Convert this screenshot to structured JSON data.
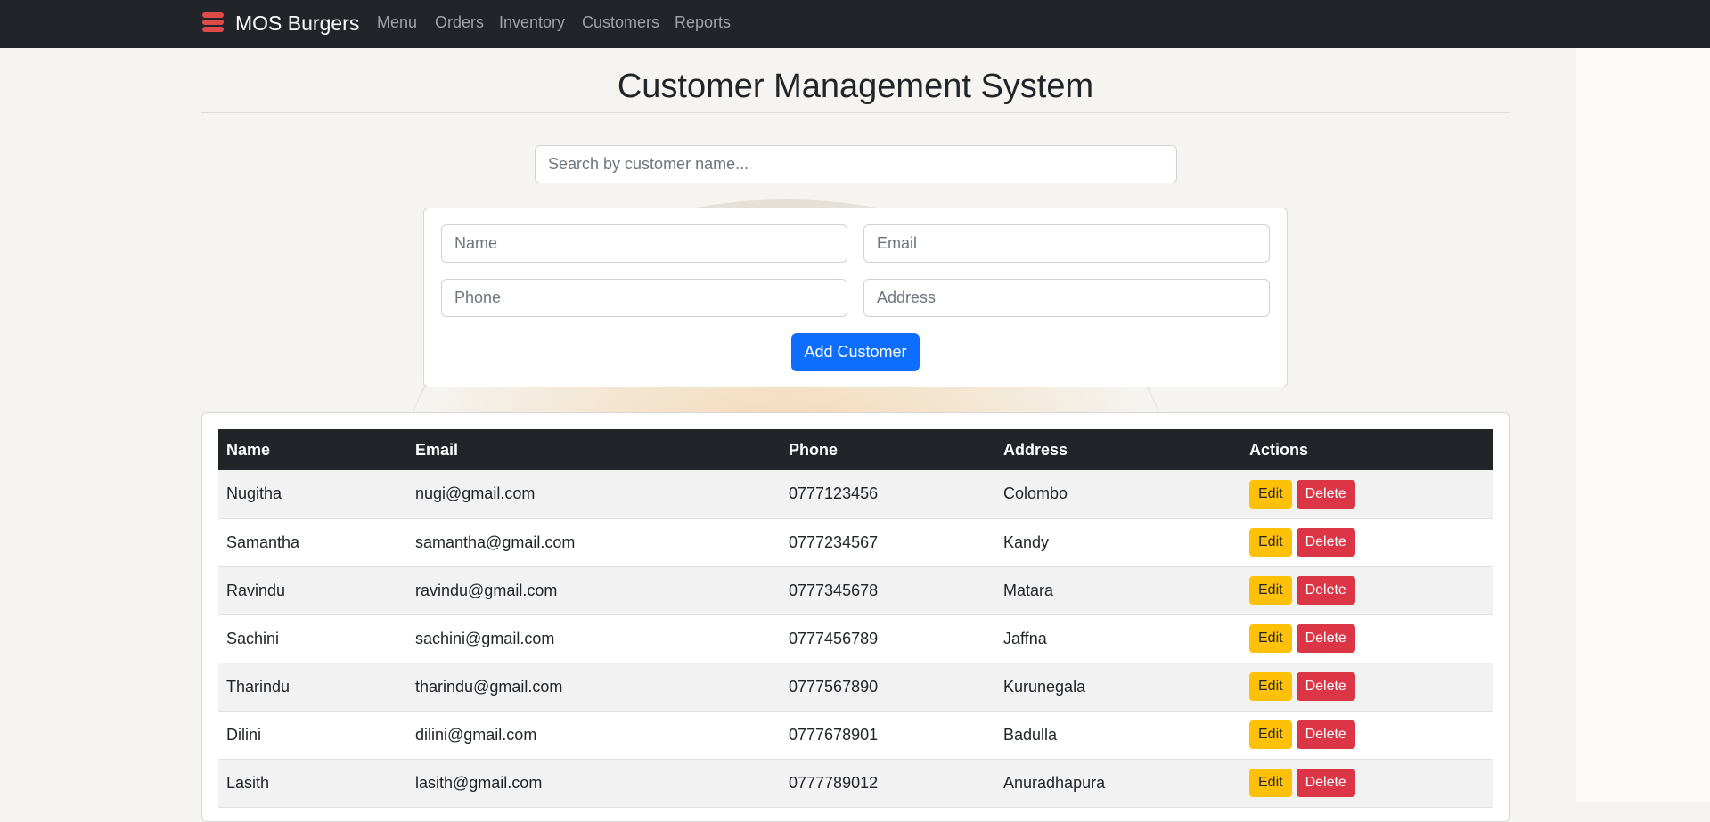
{
  "navbar": {
    "brand": "MOS Burgers",
    "brand_icon": "burger-icon",
    "links": [
      "Menu",
      "Orders",
      "Inventory",
      "Customers",
      "Reports"
    ]
  },
  "page": {
    "title": "Customer Management System"
  },
  "search": {
    "placeholder": "Search by customer name..."
  },
  "form": {
    "name_placeholder": "Name",
    "email_placeholder": "Email",
    "phone_placeholder": "Phone",
    "address_placeholder": "Address",
    "submit_label": "Add Customer"
  },
  "table": {
    "headers": [
      "Name",
      "Email",
      "Phone",
      "Address",
      "Actions"
    ],
    "edit_label": "Edit",
    "delete_label": "Delete",
    "rows": [
      {
        "name": "Nugitha",
        "email": "nugi@gmail.com",
        "phone": "0777123456",
        "address": "Colombo"
      },
      {
        "name": "Samantha",
        "email": "samantha@gmail.com",
        "phone": "0777234567",
        "address": "Kandy"
      },
      {
        "name": "Ravindu",
        "email": "ravindu@gmail.com",
        "phone": "0777345678",
        "address": "Matara"
      },
      {
        "name": "Sachini",
        "email": "sachini@gmail.com",
        "phone": "0777456789",
        "address": "Jaffna"
      },
      {
        "name": "Tharindu",
        "email": "tharindu@gmail.com",
        "phone": "0777567890",
        "address": "Kurunegala"
      },
      {
        "name": "Dilini",
        "email": "dilini@gmail.com",
        "phone": "0777678901",
        "address": "Badulla"
      },
      {
        "name": "Lasith",
        "email": "lasith@gmail.com",
        "phone": "0777789012",
        "address": "Anuradhapura"
      }
    ]
  },
  "colors": {
    "navbar": "#212529",
    "primary": "#0d6efd",
    "warning": "#ffc107",
    "danger": "#dc3545",
    "brand_icon": "#e04a4a"
  }
}
